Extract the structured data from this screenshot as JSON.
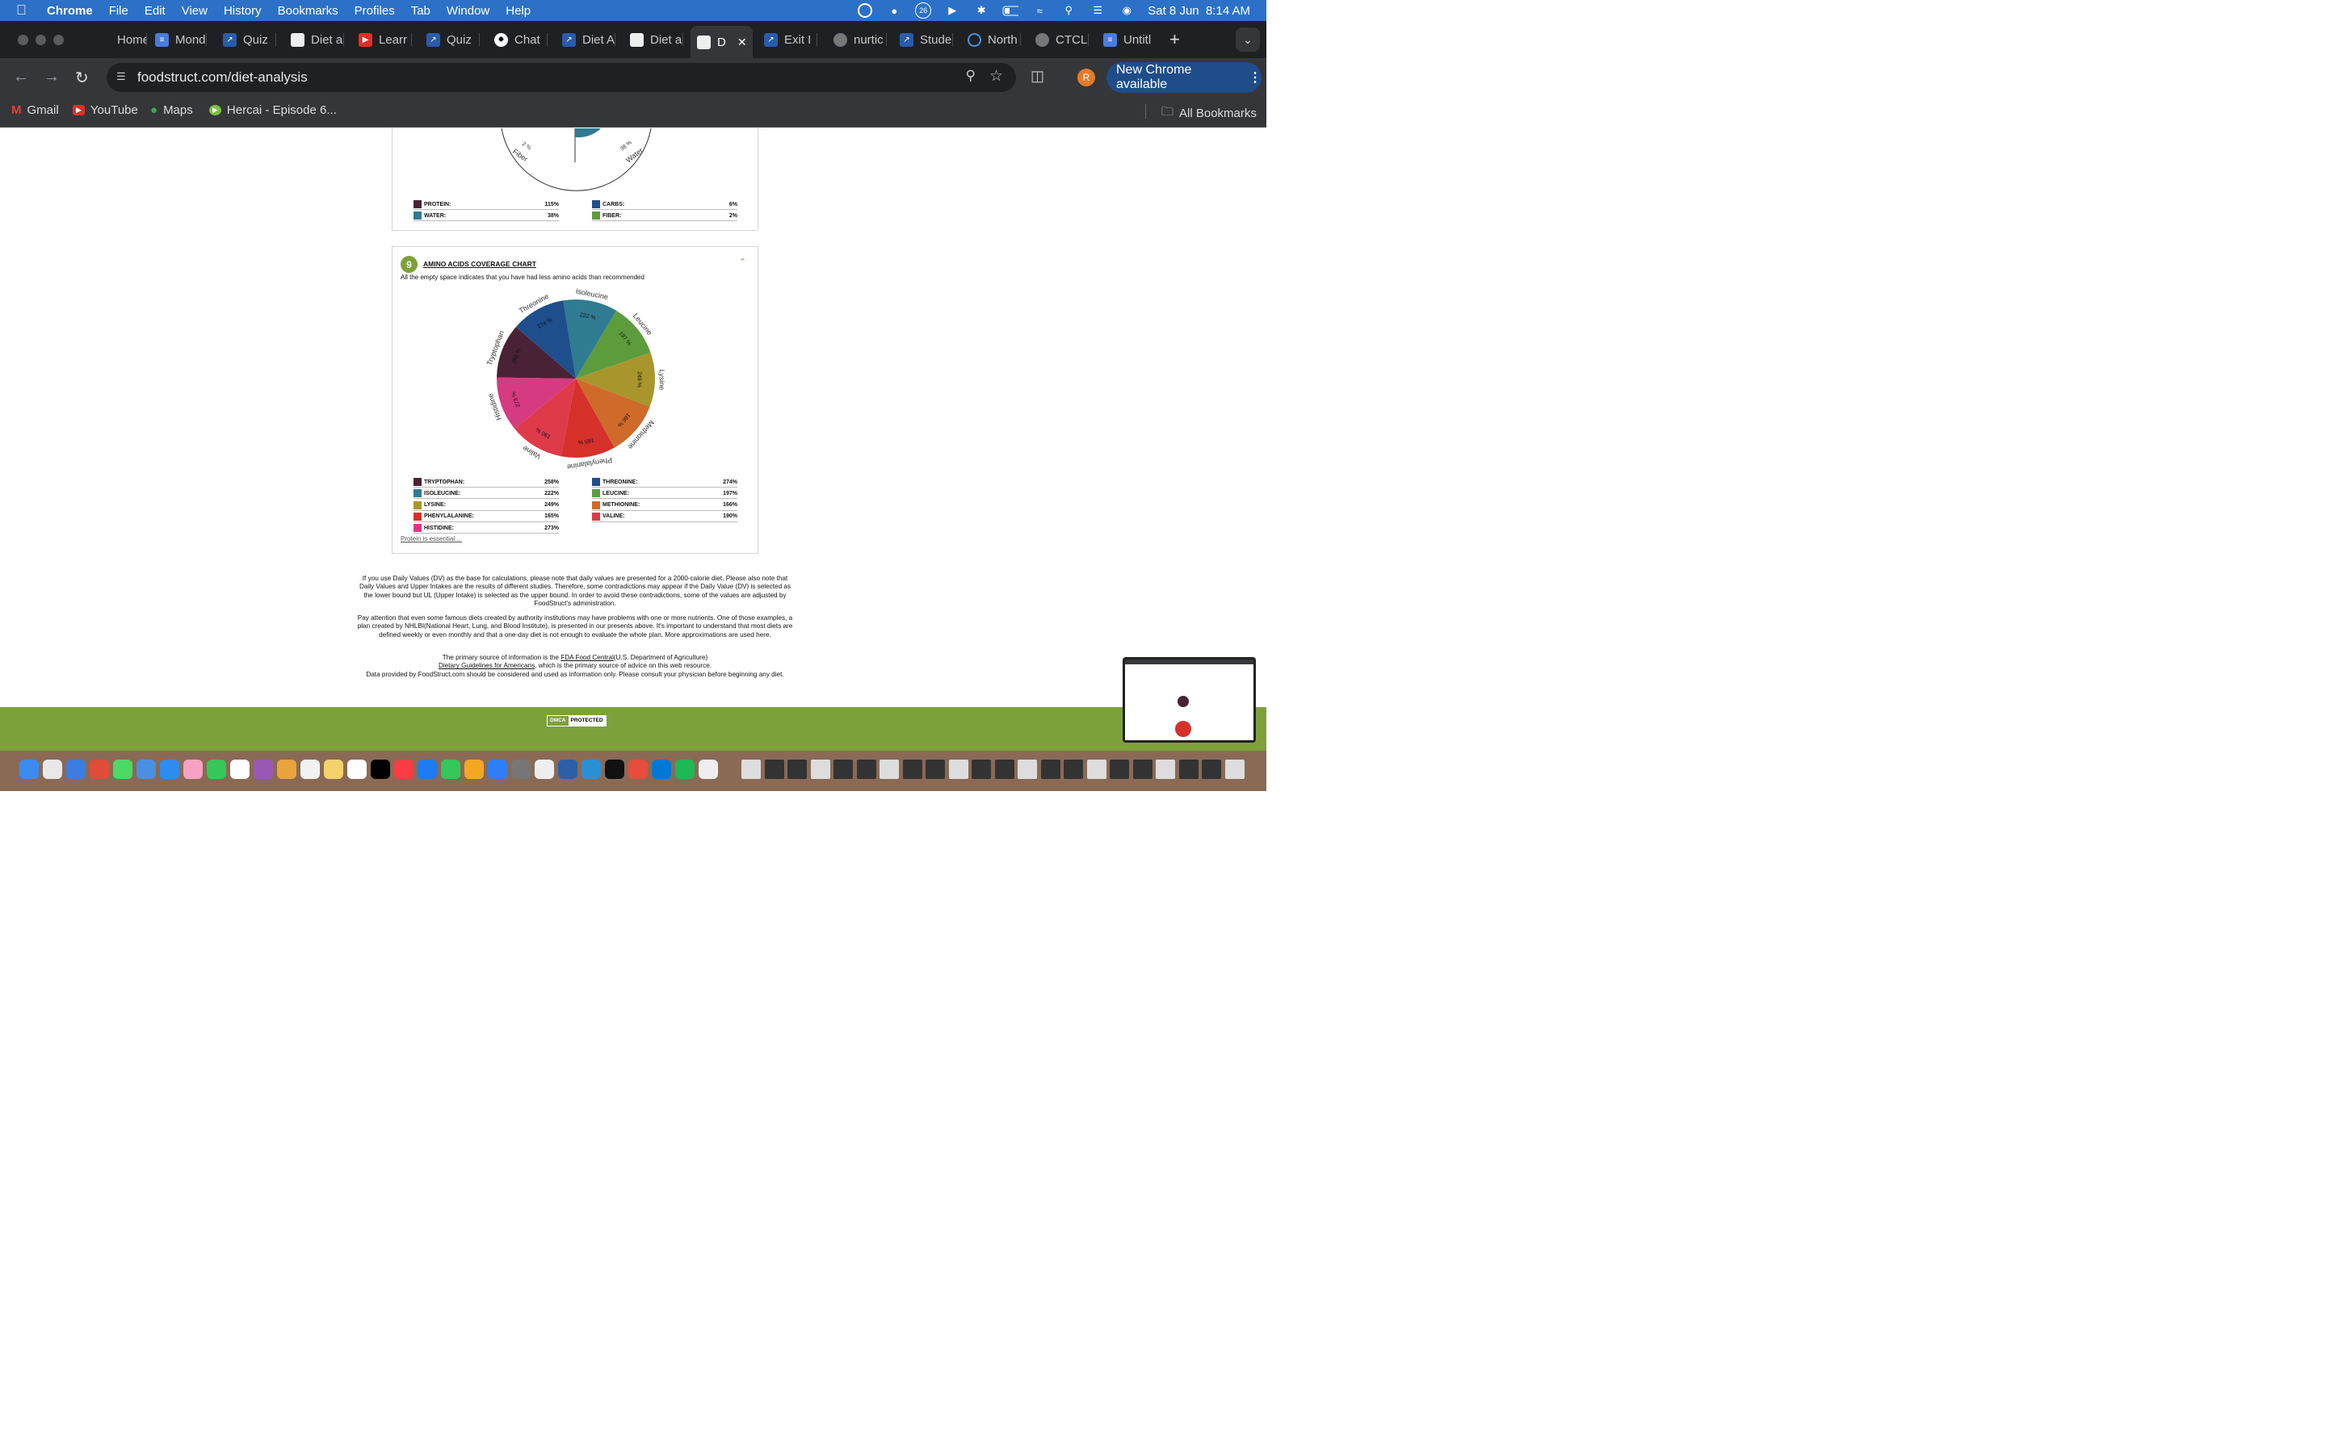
{
  "menubar": {
    "app": "Chrome",
    "items": [
      "File",
      "Edit",
      "View",
      "History",
      "Bookmarks",
      "Profiles",
      "Tab",
      "Window",
      "Help"
    ],
    "status_badge": "26",
    "datetime": "Sat 8 Jun  8:14 AM"
  },
  "tabs": [
    {
      "label": "Home"
    },
    {
      "label": "Mond"
    },
    {
      "label": "Quiz"
    },
    {
      "label": "Diet a"
    },
    {
      "label": "Learr"
    },
    {
      "label": "Quiz"
    },
    {
      "label": "Chat"
    },
    {
      "label": "Diet A"
    },
    {
      "label": "Diet a"
    },
    {
      "label": "D"
    },
    {
      "label": "Exit I"
    },
    {
      "label": "nurtic"
    },
    {
      "label": "Stude"
    },
    {
      "label": "North"
    },
    {
      "label": "CTCL"
    },
    {
      "label": "Untitl"
    }
  ],
  "toolbar": {
    "url": "foodstruct.com/diet-analysis",
    "avatar": "R",
    "update_label": "New Chrome available"
  },
  "bookmarks": {
    "items": [
      "Gmail",
      "YouTube",
      "Maps",
      "Hercai - Episode 6..."
    ],
    "all_label": "All Bookmarks"
  },
  "macro_chart": {
    "fiber_label": "Fiber",
    "fiber_pct": "2 %",
    "water_label": "Water",
    "water_pct": "38 %",
    "legend": [
      {
        "name": "PROTEIN:",
        "value": "115%",
        "color": "#4a2236"
      },
      {
        "name": "CARBS:",
        "value": "6%",
        "color": "#1f4e8c"
      },
      {
        "name": "WATER:",
        "value": "38%",
        "color": "#2f7b92"
      },
      {
        "name": "FIBER:",
        "value": "2%",
        "color": "#5c9c3c"
      }
    ]
  },
  "amino": {
    "number": "9",
    "title": "AMINO ACIDS COVERAGE CHART",
    "subtitle": "All the empty space indicates that you have had less amino acids than recommended",
    "link": "Protein is essential ...",
    "legend": [
      {
        "name": "TRYPTOPHAN:",
        "value": "258%",
        "color": "#4a2236"
      },
      {
        "name": "THREONINE:",
        "value": "274%",
        "color": "#1f4e8c"
      },
      {
        "name": "ISOLEUCINE:",
        "value": "222%",
        "color": "#2f7b92"
      },
      {
        "name": "LEUCINE:",
        "value": "197%",
        "color": "#5c9c3c"
      },
      {
        "name": "LYSINE:",
        "value": "249%",
        "color": "#a8962c"
      },
      {
        "name": "METHIONINE:",
        "value": "166%",
        "color": "#cf6a2a"
      },
      {
        "name": "PHENYLALANINE:",
        "value": "165%",
        "color": "#d6312a"
      },
      {
        "name": "VALINE:",
        "value": "190%",
        "color": "#df3a4a"
      },
      {
        "name": "HISTIDINE:",
        "value": "273%",
        "color": "#d63a80"
      }
    ]
  },
  "chart_data": {
    "type": "pie",
    "categories": [
      "Isoleucine",
      "Leucine",
      "Lysine",
      "Methionine",
      "Phenylalanine",
      "Valine",
      "Histidine",
      "Tryptophan",
      "Threonine"
    ],
    "values": [
      222,
      197,
      249,
      166,
      165,
      190,
      273,
      258,
      274
    ],
    "labels": [
      "222 %",
      "197 %",
      "249 %",
      "166 %",
      "165 %",
      "190 %",
      "273 %",
      "258 %",
      "274 %"
    ],
    "colors": [
      "#2f7b92",
      "#5c9c3c",
      "#a8962c",
      "#cf6a2a",
      "#d6312a",
      "#df3a4a",
      "#d63a80",
      "#4a2236",
      "#1f4e8c"
    ]
  },
  "notes": {
    "p1": "If you use Daily Values (DV) as the base for calculations, please note that daily values are presented for a 2000-calorie diet. Please also note that Daily Values and Upper Intakes are the results of different studies. Therefore, some contradictions may appear if the Daily Value (DV) is selected as the lower bound but UL (Upper Intake) is selected as the upper bound. In order to avoid these contradictions, some of the values are adjusted by FoodStruct's administration.",
    "p2": "Pay attention that even some famous diets created by authority institutions may have problems with one or more nutrients. One of those examples, a plan created by NHLBI(National Heart, Lung, and Blood Institute), is presented in our presents above. It's important to understand that most diets are defined weekly or even monthly and that a one-day diet is not enough to evaluate the whole plan. More approximations are used here.",
    "p3_a": "The primary source of information is the",
    "p3_link": "FDA Food Central",
    "p3_b": "(U.S. Department of Agriculture)",
    "p4_link": "Dietary Guidelines for Americans",
    "p4_b": ", which is the primary source of advice on this web resource.",
    "p5": "Data provided by FoodStruct.com should be considered and used as information only. Please consult your physician before beginning any diet."
  },
  "footer": {
    "dmca_a": "DMCA",
    "dmca_b": "PROTECTED"
  }
}
